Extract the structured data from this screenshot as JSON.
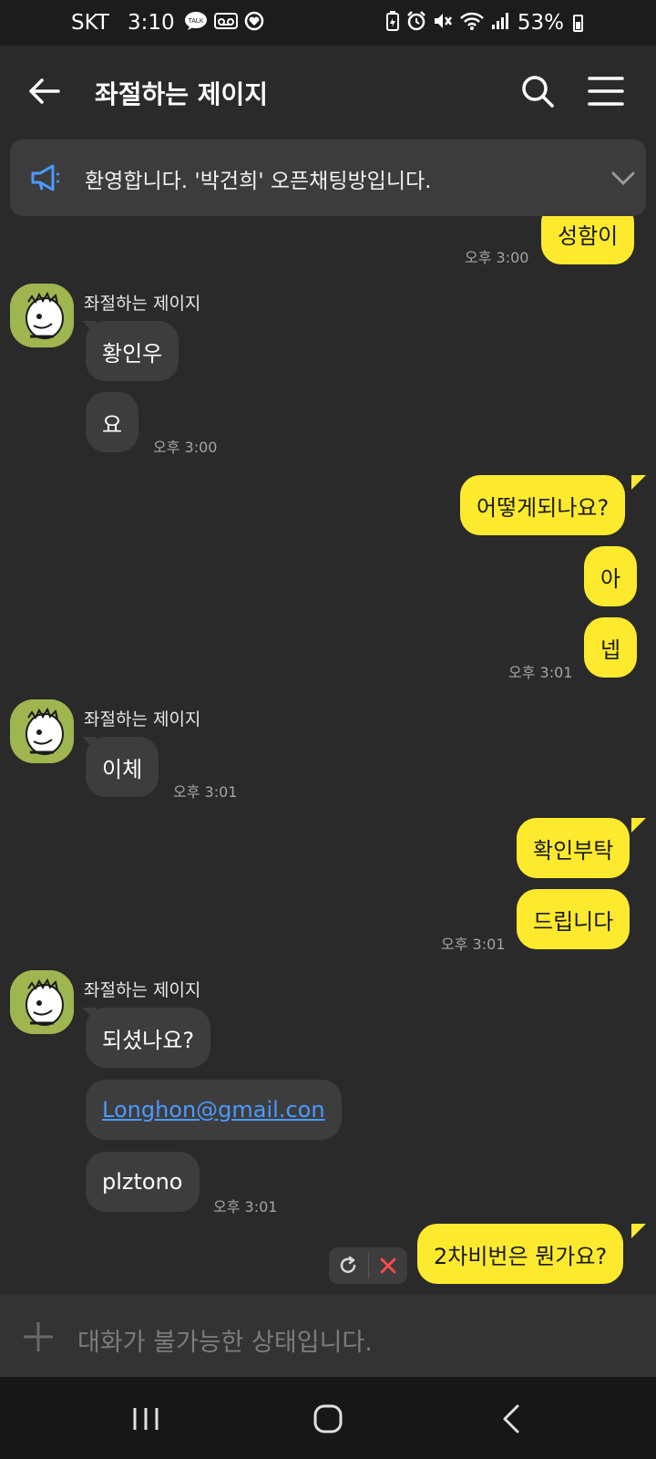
{
  "status_bar": {
    "carrier": "SKT",
    "time": "3:10",
    "battery_percent": "53%",
    "icons": [
      "talk-icon",
      "voicemail-icon",
      "heart-icon",
      "battery-saver-icon",
      "alarm-icon",
      "mute-icon",
      "wifi-icon",
      "signal-icon"
    ]
  },
  "header": {
    "title": "좌절하는 제이지"
  },
  "notice": {
    "text": "환영합니다. '박건희' 오픈채팅방입니다."
  },
  "messages": [
    {
      "dir": "out",
      "text": "성함이",
      "time": "오후 3:00"
    },
    {
      "dir": "in",
      "sender": "좌절하는 제이지",
      "text": "황인우"
    },
    {
      "dir": "in",
      "text": "요",
      "time": "오후 3:00"
    },
    {
      "dir": "out",
      "text": "어떻게되나요?"
    },
    {
      "dir": "out",
      "text": "아"
    },
    {
      "dir": "out",
      "text": "넵",
      "time": "오후 3:01"
    },
    {
      "dir": "in",
      "sender": "좌절하는 제이지",
      "text": "이체",
      "time": "오후 3:01"
    },
    {
      "dir": "out",
      "text": "확인부탁"
    },
    {
      "dir": "out",
      "text": "드립니다",
      "time": "오후 3:01"
    },
    {
      "dir": "in",
      "sender": "좌절하는 제이지",
      "text": "되셨나요?"
    },
    {
      "dir": "in",
      "text": "Longhon@gmail.con",
      "link": true
    },
    {
      "dir": "in",
      "text": "plztono",
      "time": "오후 3:01"
    },
    {
      "dir": "out",
      "text": "2차비번은 뭔가요?",
      "failed": true
    }
  ],
  "input": {
    "placeholder": "대화가 불가능한 상태입니다."
  },
  "colors": {
    "background": "#2a2a2a",
    "outgoing_bubble": "#fdea2e",
    "incoming_bubble": "#3d3d3d",
    "link": "#4c9aff",
    "retry_cancel": "#ff4b4b"
  }
}
